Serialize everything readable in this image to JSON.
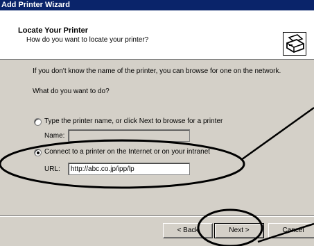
{
  "window": {
    "title": "Add Printer Wizard"
  },
  "header": {
    "title": "Locate Your Printer",
    "subtitle": "How do you want to locate your printer?",
    "icon": "printer-icon"
  },
  "content": {
    "intro": "If you don't know the name of the printer, you can browse for one on the network.",
    "question": "What do you want to do?",
    "option_name": {
      "label": "Type the printer name, or click Next to browse for a printer",
      "selected": false
    },
    "name_label": "Name:",
    "name_value": "",
    "option_url": {
      "label": "Connect to a printer on the Internet or on your intranet",
      "selected": true
    },
    "url_label": "URL:",
    "url_value": "http://abc.co.jp/ipp/lp"
  },
  "footer": {
    "back_label": "< Back",
    "next_label": "Next >",
    "cancel_label": "Cancel"
  },
  "colors": {
    "titlebar": "#0a246a",
    "dialog": "#d4d0c8",
    "annotation": "#000000"
  }
}
